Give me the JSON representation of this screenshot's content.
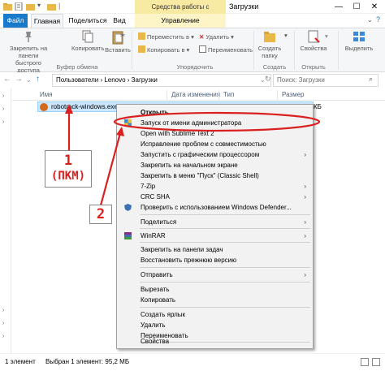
{
  "titlebar": {
    "context_tab": "Средства работы с приложениями",
    "title": "Загрузки",
    "minimize": "—",
    "maximize": "☐",
    "close": "✕"
  },
  "tabs": {
    "file": "Файл",
    "home": "Главная",
    "share": "Поделиться",
    "view": "Вид",
    "manage": "Управление"
  },
  "ribbon": {
    "pin_label": "Закрепить на панели быстрого доступа",
    "pin_l1": "Закрепить на панели",
    "pin_l2": "быстрого доступа",
    "copy_label": "Копировать",
    "paste_label": "Вставить",
    "clipboard_group": "Буфер обмена",
    "move_to": "Переместить в",
    "copy_to": "Копировать в",
    "delete": "Удалить",
    "rename": "Переименовать",
    "organize_group": "Упорядочить",
    "new_folder_l1": "Создать",
    "new_folder_l2": "папку",
    "create_group": "Создать",
    "properties": "Свойства",
    "open_group": "Открыть",
    "select": "Выделить"
  },
  "address": {
    "path": "Пользователи  ›  Lenovo  ›  Загрузки",
    "search_placeholder": "Поиск: Загрузки"
  },
  "columns": {
    "name": "Имя",
    "date": "Дата изменения",
    "type": "Тип",
    "size": "Размер"
  },
  "file": {
    "name": "robotrack-windows.exe",
    "size_tail": "КБ"
  },
  "context_menu": {
    "items": [
      {
        "label": "Открыть",
        "bold": true,
        "submenu": false
      },
      {
        "label": "Запуск от имени администратора",
        "bold": false,
        "submenu": false
      },
      {
        "label": "Open with Sublime Text 2",
        "bold": false,
        "submenu": false
      },
      {
        "label": "Исправление проблем с совместимостью",
        "bold": false,
        "submenu": false
      },
      {
        "label": "Запустить с графическим процессором",
        "bold": false,
        "submenu": true
      },
      {
        "label": "Закрепить на начальном экране",
        "bold": false,
        "submenu": false
      },
      {
        "label": "Закрепить в меню \"Пуск\" (Classic Shell)",
        "bold": false,
        "submenu": false
      },
      {
        "label": "7-Zip",
        "bold": false,
        "submenu": true
      },
      {
        "label": "CRC SHA",
        "bold": false,
        "submenu": true
      },
      {
        "label": "Проверить с использованием Windows Defender...",
        "bold": false,
        "submenu": false
      },
      {
        "label": "Поделиться",
        "bold": false,
        "submenu": true
      },
      {
        "label": "WinRAR",
        "bold": false,
        "submenu": true
      },
      {
        "label": "Закрепить на панели задач",
        "bold": false,
        "submenu": false
      },
      {
        "label": "Восстановить прежнюю версию",
        "bold": false,
        "submenu": false
      },
      {
        "label": "Отправить",
        "bold": false,
        "submenu": true
      },
      {
        "label": "Вырезать",
        "bold": false,
        "submenu": false
      },
      {
        "label": "Копировать",
        "bold": false,
        "submenu": false
      },
      {
        "label": "Создать ярлык",
        "bold": false,
        "submenu": false
      },
      {
        "label": "Удалить",
        "bold": false,
        "submenu": false
      },
      {
        "label": "Переименовать",
        "bold": false,
        "submenu": false
      },
      {
        "label": "Свойства",
        "bold": false,
        "submenu": false
      }
    ],
    "submenu_glyph": "›"
  },
  "annotations": {
    "step1_number": "1",
    "step1_text": "(ПКМ)",
    "step2_number": "2",
    "color": "#d9201f"
  },
  "status": {
    "count": "1 элемент",
    "selected": "Выбран 1 элемент: 95,2 МБ"
  },
  "colors": {
    "file_tab": "#1979ca",
    "selection": "#cce8ff",
    "context_tab": "#f8e9a3"
  }
}
